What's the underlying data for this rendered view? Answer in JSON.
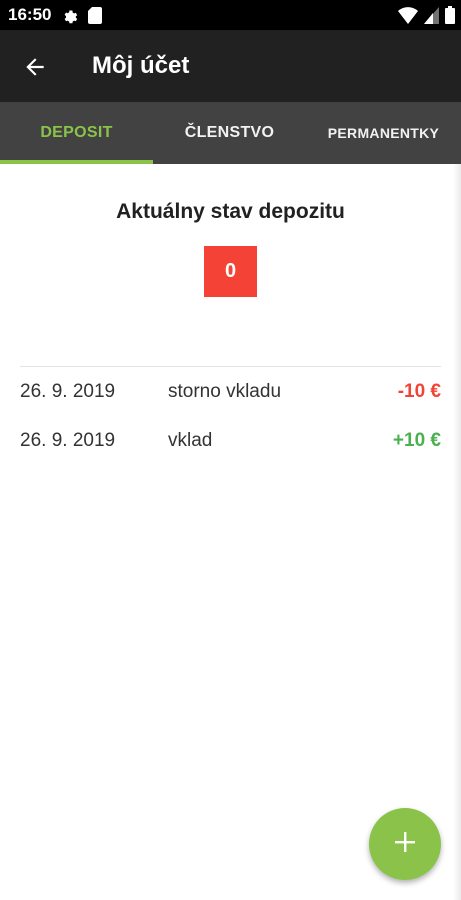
{
  "status_bar": {
    "time": "16:50",
    "icons": [
      "gear-icon",
      "sd-card-icon",
      "wifi-icon",
      "signal-icon",
      "battery-icon"
    ]
  },
  "app_bar": {
    "title": "Môj účet",
    "back_icon": "arrow-left-icon"
  },
  "tabs": [
    {
      "label": "DEPOSIT",
      "selected": true
    },
    {
      "label": "ČLENSTVO",
      "selected": false
    },
    {
      "label": "PERMANENTKY",
      "selected": false
    }
  ],
  "balance": {
    "title": "Aktuálny stav depozitu",
    "value": "0"
  },
  "transactions": [
    {
      "date": "26. 9. 2019",
      "description": "storno vkladu",
      "amount": "-10 €",
      "type": "negative"
    },
    {
      "date": "26. 9. 2019",
      "description": "vklad",
      "amount": "+10 €",
      "type": "positive"
    }
  ],
  "fab": {
    "icon": "plus-icon"
  },
  "colors": {
    "accent": "#8bc34a",
    "negative": "#f44336",
    "positive": "#4caf50",
    "app_bar": "#212121",
    "tab_bar": "#424242"
  }
}
